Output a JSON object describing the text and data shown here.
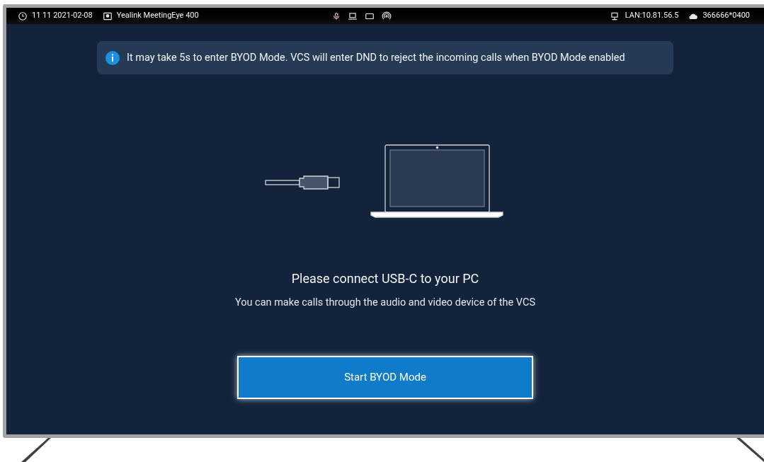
{
  "status_bar": {
    "time": "11 11 2021-02-08",
    "device": "Yealink MeetingEye 400",
    "mic_muted": true,
    "network": "LAN:10.81.56.5",
    "account": "366666*0400"
  },
  "notice": {
    "text": "It may take 5s to enter BYOD Mode. VCS will enter DND to reject the incoming calls when BYOD Mode enabled"
  },
  "title": "Please connect USB-C to your PC",
  "subtitle": "You can make calls through the audio and video device of the VCS",
  "button": {
    "label": "Start BYOD Mode",
    "focused": true
  }
}
